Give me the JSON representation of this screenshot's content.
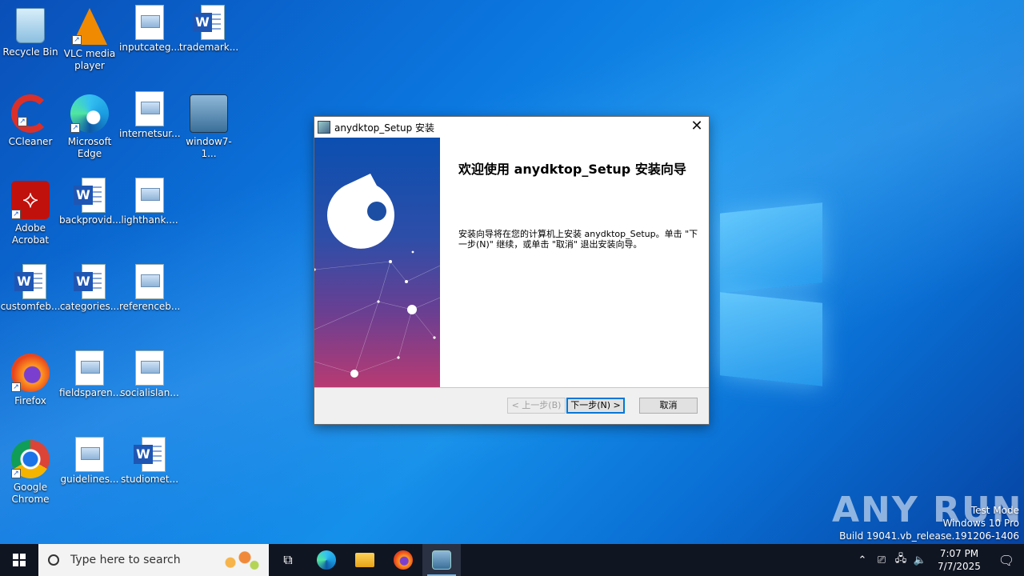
{
  "desktop_icons": [
    {
      "label": "Recycle Bin",
      "icon": "recycle-bin-icon"
    },
    {
      "label": "VLC media player",
      "icon": "vlc-icon"
    },
    {
      "label": "inputcateg...",
      "icon": "image-file-icon"
    },
    {
      "label": "trademark...",
      "icon": "word-doc-icon"
    },
    {
      "label": "CCleaner",
      "icon": "ccleaner-icon"
    },
    {
      "label": "Microsoft Edge",
      "icon": "edge-icon"
    },
    {
      "label": "internetsur...",
      "icon": "image-file-icon"
    },
    {
      "label": "window7-1...",
      "icon": "installer-icon"
    },
    {
      "label": "Adobe Acrobat",
      "icon": "acrobat-icon"
    },
    {
      "label": "backprovid...",
      "icon": "word-doc-icon"
    },
    {
      "label": "lighthank....",
      "icon": "image-file-icon"
    },
    {
      "label": "customfeb...",
      "icon": "word-doc-icon"
    },
    {
      "label": "categories...",
      "icon": "word-doc-icon"
    },
    {
      "label": "referenceb...",
      "icon": "image-file-icon"
    },
    {
      "label": "Firefox",
      "icon": "firefox-icon"
    },
    {
      "label": "fieldsparen...",
      "icon": "image-file-icon"
    },
    {
      "label": "socialislan...",
      "icon": "image-file-icon"
    },
    {
      "label": "Google Chrome",
      "icon": "chrome-icon"
    },
    {
      "label": "guidelines...",
      "icon": "image-file-icon"
    },
    {
      "label": "studiomet...",
      "icon": "word-doc-icon"
    }
  ],
  "dialog": {
    "title": "anydktop_Setup 安装",
    "heading": "欢迎使用 anydktop_Setup 安装向导",
    "body": "安装向导将在您的计算机上安装 anydktop_Setup。单击 \"下一步(N)\" 继续，或单击 \"取消\" 退出安装向导。",
    "back_label": "< 上一步(B)",
    "next_label": "下一步(N) >",
    "cancel_label": "取消"
  },
  "watermark": {
    "brand": "ANY RUN",
    "line1": "Test Mode",
    "line2": "Windows 10 Pro",
    "line3": "Build 19041.vb_release.191206-1406"
  },
  "taskbar": {
    "search_placeholder": "Type here to search",
    "time": "7:07 PM",
    "date": "7/7/2025"
  }
}
